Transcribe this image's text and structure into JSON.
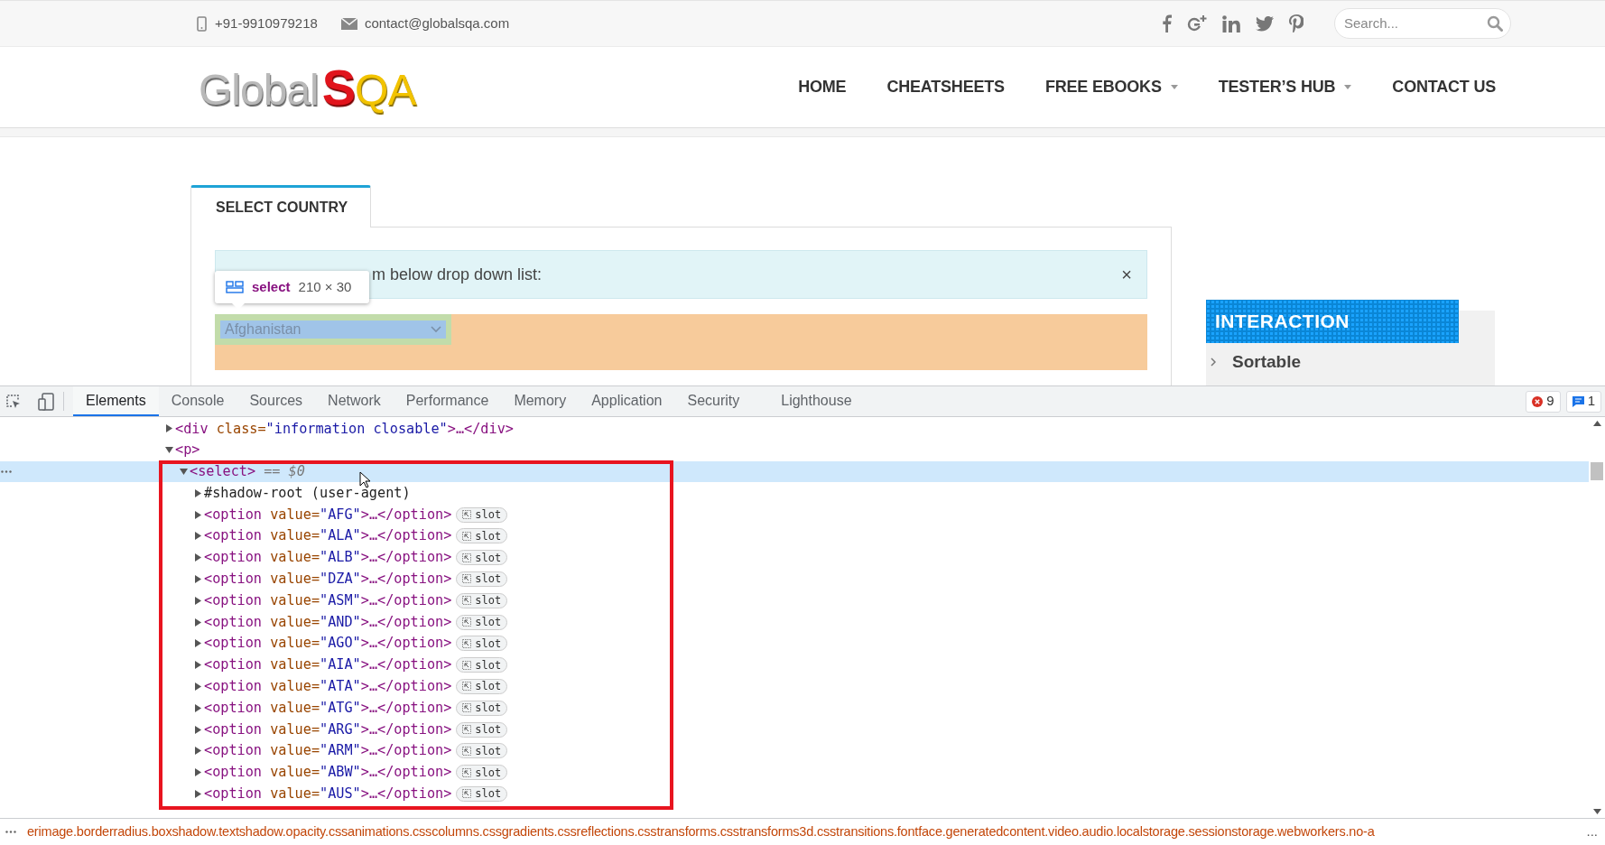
{
  "top_bar": {
    "phone": "+91-9910979218",
    "email": "contact@globalsqa.com",
    "search": {
      "placeholder": "Search..."
    }
  },
  "logo": {
    "first": "Global",
    "second": "S",
    "third": "QA"
  },
  "nav": [
    {
      "label": "HOME",
      "dropdown": false
    },
    {
      "label": "CHEATSHEETS",
      "dropdown": false
    },
    {
      "label": "FREE EBOOKS",
      "dropdown": true
    },
    {
      "label": "TESTER’S HUB",
      "dropdown": true
    },
    {
      "label": "CONTACT US",
      "dropdown": false
    }
  ],
  "tab": {
    "label": "SELECT COUNTRY"
  },
  "alert": {
    "text": "m below drop down list:",
    "close": "×"
  },
  "tooltip": {
    "tag": "select",
    "size": "210 × 30"
  },
  "select": {
    "value": "Afghanistan"
  },
  "sidebar": {
    "title": "INTERACTION",
    "items": [
      {
        "label": "Sortable"
      }
    ]
  },
  "devtools": {
    "tabs": [
      {
        "label": "Elements",
        "selected": true
      },
      {
        "label": "Console",
        "selected": false
      },
      {
        "label": "Sources",
        "selected": false
      },
      {
        "label": "Network",
        "selected": false
      },
      {
        "label": "Performance",
        "selected": false
      },
      {
        "label": "Memory",
        "selected": false
      },
      {
        "label": "Application",
        "selected": false
      },
      {
        "label": "Security",
        "selected": false
      },
      {
        "label": "Lighthouse",
        "selected": false
      }
    ],
    "errors": "9",
    "messages": "1",
    "tree": [
      {
        "kind": "element",
        "text": "<div class=\"information closable\">…</div>",
        "expanded": false,
        "selected": false
      },
      {
        "kind": "element",
        "text": "<p>",
        "expanded": true,
        "selected": false,
        "children": [
          {
            "kind": "element",
            "text": "<select>",
            "suffix": "== $0",
            "expanded": true,
            "selected": true,
            "children": [
              {
                "kind": "shadow",
                "text": "#shadow-root (user-agent)",
                "expanded": false,
                "selected": false
              },
              {
                "kind": "element",
                "text": "<option value=\"AFG\">…</option>",
                "badge": "slot",
                "expanded": false,
                "selected": false
              },
              {
                "kind": "element",
                "text": "<option value=\"ALA\">…</option>",
                "badge": "slot",
                "expanded": false,
                "selected": false
              },
              {
                "kind": "element",
                "text": "<option value=\"ALB\">…</option>",
                "badge": "slot",
                "expanded": false,
                "selected": false
              },
              {
                "kind": "element",
                "text": "<option value=\"DZA\">…</option>",
                "badge": "slot",
                "expanded": false,
                "selected": false
              },
              {
                "kind": "element",
                "text": "<option value=\"ASM\">…</option>",
                "badge": "slot",
                "expanded": false,
                "selected": false
              },
              {
                "kind": "element",
                "text": "<option value=\"AND\">…</option>",
                "badge": "slot",
                "expanded": false,
                "selected": false
              },
              {
                "kind": "element",
                "text": "<option value=\"AGO\">…</option>",
                "badge": "slot",
                "expanded": false,
                "selected": false
              },
              {
                "kind": "element",
                "text": "<option value=\"AIA\">…</option>",
                "badge": "slot",
                "expanded": false,
                "selected": false
              },
              {
                "kind": "element",
                "text": "<option value=\"ATA\">…</option>",
                "badge": "slot",
                "expanded": false,
                "selected": false
              },
              {
                "kind": "element",
                "text": "<option value=\"ATG\">…</option>",
                "badge": "slot",
                "expanded": false,
                "selected": false
              },
              {
                "kind": "element",
                "text": "<option value=\"ARG\">…</option>",
                "badge": "slot",
                "expanded": false,
                "selected": false
              },
              {
                "kind": "element",
                "text": "<option value=\"ARM\">…</option>",
                "badge": "slot",
                "expanded": false,
                "selected": false
              },
              {
                "kind": "element",
                "text": "<option value=\"ABW\">…</option>",
                "badge": "slot",
                "expanded": false,
                "selected": false
              },
              {
                "kind": "element",
                "text": "<option value=\"AUS\">…</option>",
                "badge": "slot",
                "expanded": false,
                "selected": false
              }
            ]
          }
        ]
      }
    ]
  },
  "status": {
    "text": "erimage.borderradius.boxshadow.textshadow.opacity.cssanimations.csscolumns.cssgradients.cssreflections.csstransforms.csstransforms3d.csstransitions.fontface.generatedcontent.video.audio.localstorage.sessionstorage.webworkers.no-a",
    "more": "..."
  }
}
